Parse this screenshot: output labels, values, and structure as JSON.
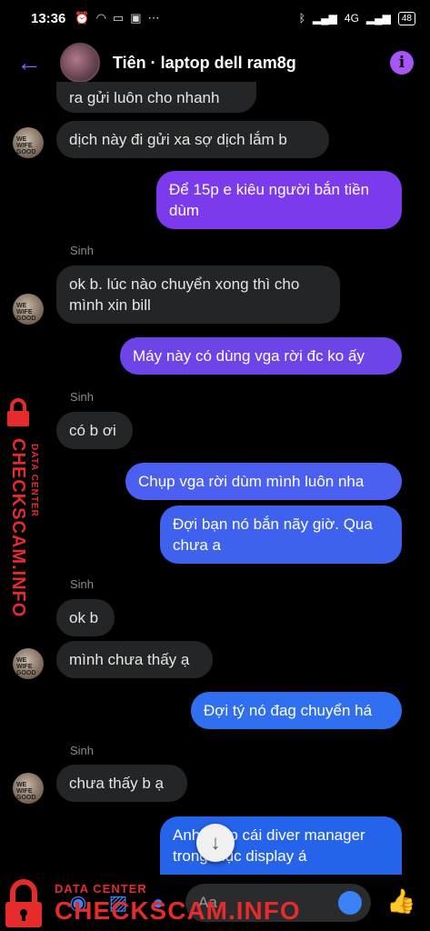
{
  "status_bar": {
    "time": "13:36",
    "icons": [
      "alarm-icon",
      "wifi-icon",
      "sim-icon",
      "shield-icon",
      "more-icon",
      "bluetooth-icon",
      "signal-icon",
      "signal-4g-icon"
    ],
    "network": "4G",
    "battery": "48"
  },
  "header": {
    "title": "Tiên · laptop dell ram8g",
    "back_icon": "←",
    "info_icon": "i"
  },
  "messages": {
    "m0": "ra gửi luôn cho nhanh",
    "m1": "dịch này đi gửi xa sợ dịch lắm b",
    "m2": "Để 15p e kiêu người bắn tiền dùm",
    "s1": "Sinh",
    "m3": "ok b. lúc nào chuyển xong thì cho mình xin bill",
    "m4": "Máy này có dùng vga rời đc ko ấy",
    "s2": "Sinh",
    "m5": "có b ơi",
    "m6": "Chụp vga rời dùm mình luôn nha",
    "m7": "Đợi bạn nó bắn nãy giờ. Qua chưa a",
    "s3": "Sinh",
    "m8": "ok b",
    "m9": "mình chưa thấy ạ",
    "m10": "Đợi tý nó đag chuyển há",
    "s4": "Sinh",
    "m11": "chưa thấy b ạ",
    "m12": "Anh chụp cái diver manager trong mục display á"
  },
  "avatar_text": "WE WIFE GOOD",
  "composer": {
    "placeholder": "Aa",
    "icons": [
      "camera-icon",
      "image-icon",
      "microphone-icon",
      "emoji-icon",
      "like-icon"
    ]
  },
  "watermark": {
    "side_big": "CHECKSCAM.INFO",
    "side_small": "DATA CENTER",
    "bottom_small": "DATA CENTER",
    "bottom_big": "CHECKSCAM.INFO"
  },
  "colors": {
    "accent_purple": "#7c3aed",
    "accent_blue": "#2563eb",
    "incoming_bubble": "#242526",
    "watermark_red": "#e52b2b"
  }
}
